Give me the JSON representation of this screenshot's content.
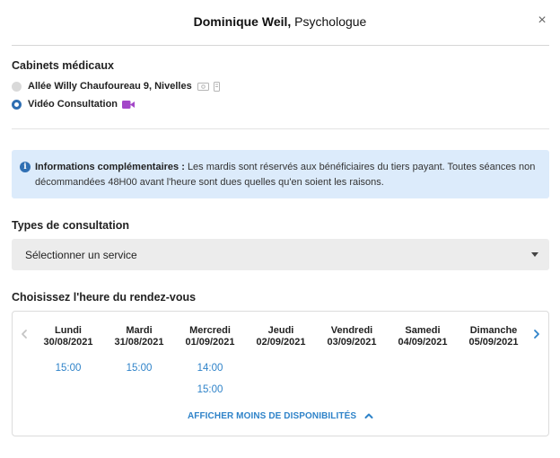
{
  "header": {
    "name": "Dominique Weil",
    "sep": ",",
    "role": "Psychologue",
    "close_glyph": "×"
  },
  "cabinets": {
    "title": "Cabinets médicaux",
    "options": [
      {
        "label": "Allée Willy Chaufoureau 9, Nivelles",
        "selected": false
      },
      {
        "label": "Vidéo Consultation",
        "selected": true
      }
    ]
  },
  "info": {
    "heading": "Informations complémentaires :",
    "text": "Les mardis sont réservés aux bénéficiaires du tiers payant. Toutes séances non décommandées 48H00 avant l'heure sont dues quelles qu'en soient les raisons."
  },
  "consultation": {
    "title": "Types de consultation",
    "select_value": "Sélectionner un service"
  },
  "calendar": {
    "title": "Choisissez l'heure du rendez-vous",
    "days": [
      {
        "name": "Lundi",
        "date": "30/08/2021",
        "slots": [
          "15:00"
        ]
      },
      {
        "name": "Mardi",
        "date": "31/08/2021",
        "slots": [
          "15:00"
        ]
      },
      {
        "name": "Mercredi",
        "date": "01/09/2021",
        "slots": [
          "14:00",
          "15:00"
        ]
      },
      {
        "name": "Jeudi",
        "date": "02/09/2021",
        "slots": []
      },
      {
        "name": "Vendredi",
        "date": "03/09/2021",
        "slots": []
      },
      {
        "name": "Samedi",
        "date": "04/09/2021",
        "slots": []
      },
      {
        "name": "Dimanche",
        "date": "05/09/2021",
        "slots": []
      }
    ],
    "more_label": "AFFICHER MOINS DE DISPONIBILITÉS"
  },
  "colors": {
    "accent": "#2f83c9",
    "radio_selected": "#2f6fb3",
    "info_bg": "#dcebfb",
    "video_icon": "#a347c8"
  },
  "icons": {
    "close": "close-icon",
    "cash": "cash-icon",
    "card": "card-icon",
    "video": "video-camera-icon",
    "info": "info-icon",
    "caret": "caret-down-icon",
    "prev": "chevron-left-icon",
    "next": "chevron-right-icon",
    "less": "chevron-up-icon"
  }
}
